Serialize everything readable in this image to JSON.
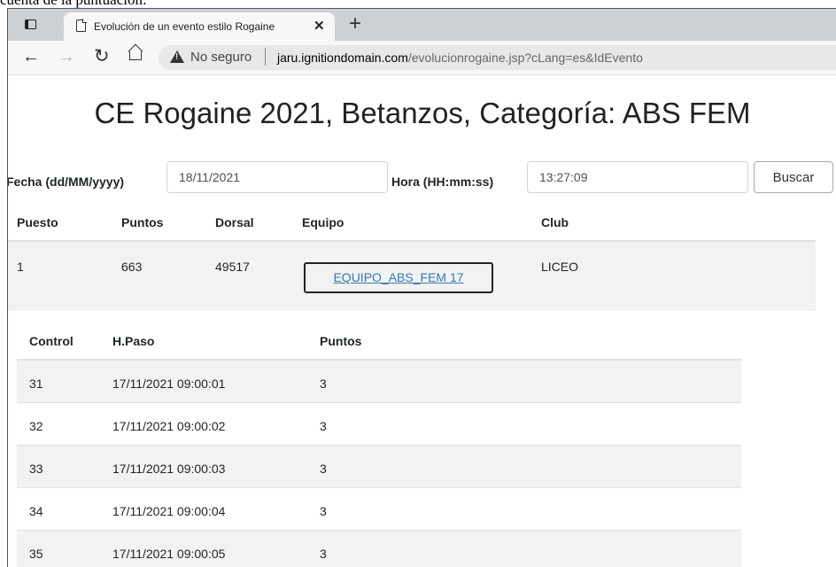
{
  "caption": "cuenta de la puntuación:",
  "browser": {
    "tab_title": "Evolución de un evento estilo Rogaine",
    "address": {
      "security": "No seguro",
      "host": "jaru.ignitiondomain.com",
      "path": "/evolucionrogaine.jsp?cLang=es&IdEvento"
    }
  },
  "page": {
    "title": "CE Rogaine 2021, Betanzos, Categoría: ABS FEM",
    "form": {
      "date_label": "Fecha (dd/MM/yyyy)",
      "date_value": "18/11/2021",
      "time_label": "Hora (HH:mm:ss)",
      "time_value": "13:27:09",
      "search_label": "Buscar"
    },
    "results": {
      "headers": [
        "Puesto",
        "Puntos",
        "Dorsal",
        "Equipo",
        "Club"
      ],
      "rows": [
        {
          "puesto": "1",
          "puntos": "663",
          "dorsal": "49517",
          "equipo": "EQUIPO_ABS_FEM 17",
          "club": "LICEO"
        }
      ]
    },
    "detail": {
      "headers": [
        "Control",
        "H.Paso",
        "Puntos"
      ],
      "rows": [
        {
          "control": "31",
          "hpaso": "17/11/2021 09:00:01",
          "puntos": "3"
        },
        {
          "control": "32",
          "hpaso": "17/11/2021 09:00:02",
          "puntos": "3"
        },
        {
          "control": "33",
          "hpaso": "17/11/2021 09:00:03",
          "puntos": "3"
        },
        {
          "control": "34",
          "hpaso": "17/11/2021 09:00:04",
          "puntos": "3"
        },
        {
          "control": "35",
          "hpaso": "17/11/2021 09:00:05",
          "puntos": "3"
        }
      ]
    }
  },
  "colors": {
    "link": "#337ab7",
    "tabstrip": "#ccd1d6",
    "stripe": "#f2f2f2"
  }
}
